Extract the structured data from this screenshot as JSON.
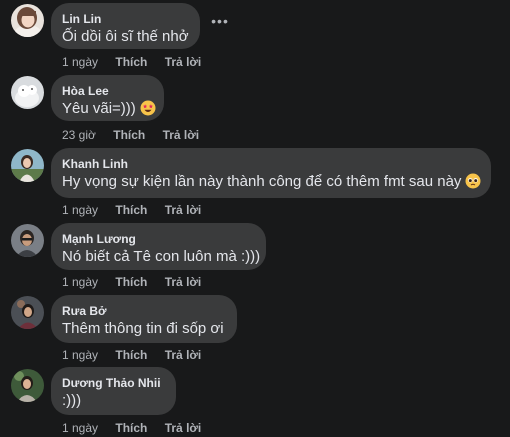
{
  "comments": [
    {
      "author": "Lin Lin",
      "text": "Ối dồi ôi sĩ thế nhở",
      "time": "1 ngày",
      "like_label": "Thích",
      "reply_label": "Trả lời",
      "more_icon": "more-horizontal-icon"
    },
    {
      "author": "Hòa Lee",
      "text": "Yêu vãi=)))",
      "emoji": "star-struck-emoji",
      "time": "23 giờ",
      "like_label": "Thích",
      "reply_label": "Trả lời"
    },
    {
      "author": "Khanh Linh",
      "text": "Hy vọng sự kiện lần này thành công để có thêm fmt sau này",
      "emoji": "pleading-face-emoji",
      "time": "1 ngày",
      "like_label": "Thích",
      "reply_label": "Trả lời"
    },
    {
      "author": "Mạnh Lương",
      "text": "Nó biết cả Tê con luôn mà :)))",
      "time": "1 ngày",
      "like_label": "Thích",
      "reply_label": "Trả lời"
    },
    {
      "author": "Rưa Bở",
      "text": "Thêm thông tin đi sốp ơi",
      "time": "1 ngày",
      "like_label": "Thích",
      "reply_label": "Trả lời"
    },
    {
      "author": "Dương Thảo Nhii",
      "text": ":)))",
      "time": "1 ngày",
      "like_label": "Thích",
      "reply_label": "Trả lời"
    }
  ],
  "colors": {
    "background": "#18191a",
    "bubble": "#3a3b3c",
    "primary_text": "#e4e6eb",
    "secondary_text": "#b0b3b8"
  }
}
